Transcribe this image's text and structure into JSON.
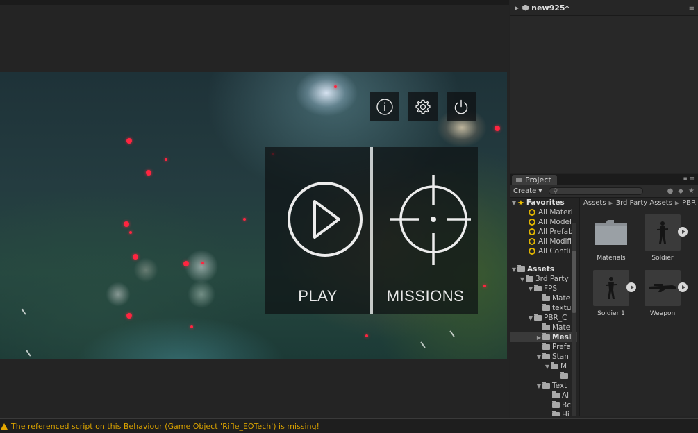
{
  "game": {
    "menu": {
      "play_label": "PLAY",
      "missions_label": "MISSIONS"
    },
    "top_buttons": [
      "info-icon",
      "gear-icon",
      "power-icon"
    ]
  },
  "console": {
    "message": "The referenced script on this Behaviour (Game Object 'Rifle_EOTech') is missing!"
  },
  "hierarchy": {
    "scene_name": "new925*"
  },
  "project": {
    "tab_label": "Project",
    "create_label": "Create ▾",
    "breadcrumb": [
      "Assets",
      "3rd Party Assets",
      "PBR"
    ],
    "tree": [
      {
        "label": "Favorites",
        "type": "star"
      },
      {
        "label": "All Materi",
        "type": "search"
      },
      {
        "label": "All Model",
        "type": "search"
      },
      {
        "label": "All Prefab",
        "type": "search"
      },
      {
        "label": "All Modifi",
        "type": "search"
      },
      {
        "label": "All Confli",
        "type": "search"
      },
      {
        "label": "Assets",
        "type": "root"
      },
      {
        "label": "3rd Party",
        "type": "folder"
      },
      {
        "label": "FPS",
        "type": "folder"
      },
      {
        "label": "Mate",
        "type": "folder"
      },
      {
        "label": "textu",
        "type": "folder"
      },
      {
        "label": "PBR_C",
        "type": "folder"
      },
      {
        "label": "Mate",
        "type": "folder"
      },
      {
        "label": "Mesl",
        "type": "folder"
      },
      {
        "label": "Prefa",
        "type": "folder"
      },
      {
        "label": "Stan",
        "type": "folder"
      },
      {
        "label": "M",
        "type": "folder"
      },
      {
        "label": "",
        "type": "folder"
      },
      {
        "label": "Text",
        "type": "folder"
      },
      {
        "label": "Al",
        "type": "folder"
      },
      {
        "label": "Bc",
        "type": "folder"
      },
      {
        "label": "Hi",
        "type": "folder"
      }
    ],
    "assets": [
      {
        "name": "Materials",
        "type": "folder"
      },
      {
        "name": "Soldier",
        "type": "model"
      },
      {
        "name": "Soldier 1",
        "type": "model"
      },
      {
        "name": "Weapon",
        "type": "model"
      }
    ]
  }
}
